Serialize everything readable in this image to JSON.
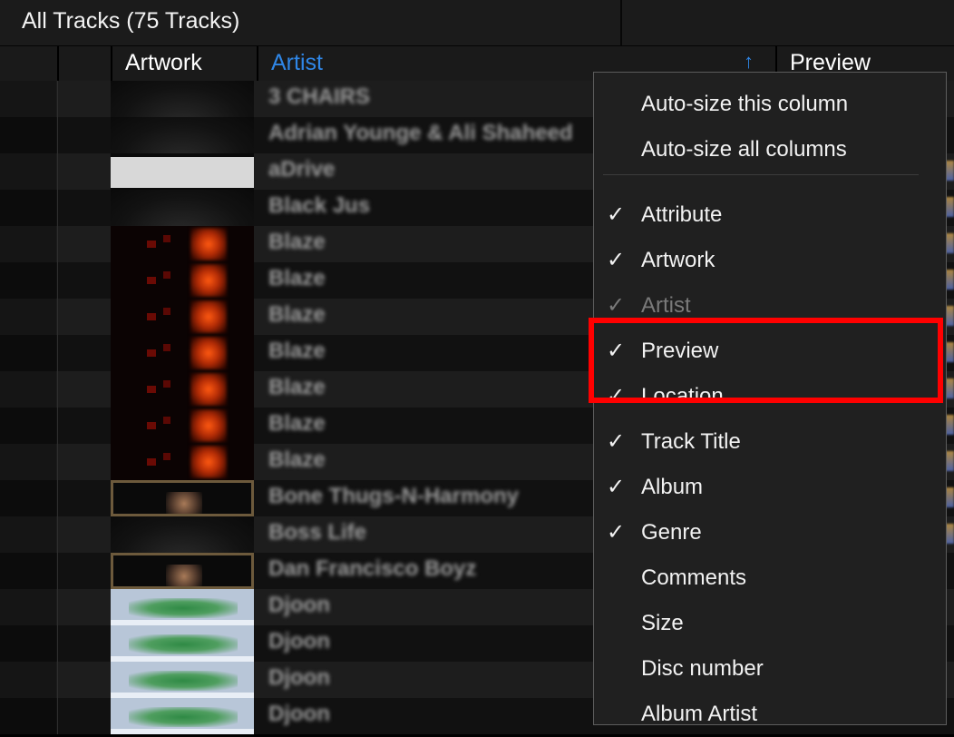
{
  "title_bar": {
    "title": "All Tracks (75 Tracks)"
  },
  "columns": {
    "artwork": "Artwork",
    "artist": "Artist",
    "sort_indicator": "↑",
    "preview": "Preview"
  },
  "colors": {
    "accent": "#2f86e6",
    "highlight_box": "#ff0000"
  },
  "context_menu": {
    "items": [
      {
        "label": "Auto-size this column",
        "checked": false,
        "disabled": false
      },
      {
        "label": "Auto-size all columns",
        "checked": false,
        "disabled": false
      },
      {
        "label": "Attribute",
        "checked": true,
        "disabled": false
      },
      {
        "label": "Artwork",
        "checked": true,
        "disabled": false
      },
      {
        "label": "Artist",
        "checked": true,
        "disabled": true
      },
      {
        "label": "Preview",
        "checked": true,
        "disabled": false
      },
      {
        "label": "Location",
        "checked": true,
        "disabled": false
      },
      {
        "label": "Track Title",
        "checked": true,
        "disabled": false
      },
      {
        "label": "Album",
        "checked": true,
        "disabled": false
      },
      {
        "label": "Genre",
        "checked": true,
        "disabled": false
      },
      {
        "label": "Comments",
        "checked": false,
        "disabled": false
      },
      {
        "label": "Size",
        "checked": false,
        "disabled": false
      },
      {
        "label": "Disc number",
        "checked": false,
        "disabled": false
      },
      {
        "label": "Album Artist",
        "checked": false,
        "disabled": false
      }
    ],
    "check_glyph": "✓"
  },
  "rows": [
    {
      "artist": "3 CHAIRS",
      "artwork": "dark"
    },
    {
      "artist": "Adrian Younge & Ali Shaheed",
      "artwork": "dark"
    },
    {
      "artist": "aDrive",
      "artwork": "white"
    },
    {
      "artist": "Black Jus",
      "artwork": "dark"
    },
    {
      "artist": "Blaze",
      "artwork": "fire"
    },
    {
      "artist": "Blaze",
      "artwork": "fire"
    },
    {
      "artist": "Blaze",
      "artwork": "fire"
    },
    {
      "artist": "Blaze",
      "artwork": "fire"
    },
    {
      "artist": "Blaze",
      "artwork": "fire"
    },
    {
      "artist": "Blaze",
      "artwork": "fire"
    },
    {
      "artist": "Blaze",
      "artwork": "fire"
    },
    {
      "artist": "Bone Thugs-N-Harmony",
      "artwork": "bronze"
    },
    {
      "artist": "Boss Life",
      "artwork": "dark"
    },
    {
      "artist": "Dan Francisco Boyz",
      "artwork": "bronze"
    },
    {
      "artist": "Djoon",
      "artwork": "green"
    },
    {
      "artist": "Djoon",
      "artwork": "green"
    },
    {
      "artist": "Djoon",
      "artwork": "green"
    },
    {
      "artist": "Djoon",
      "artwork": "green"
    }
  ]
}
